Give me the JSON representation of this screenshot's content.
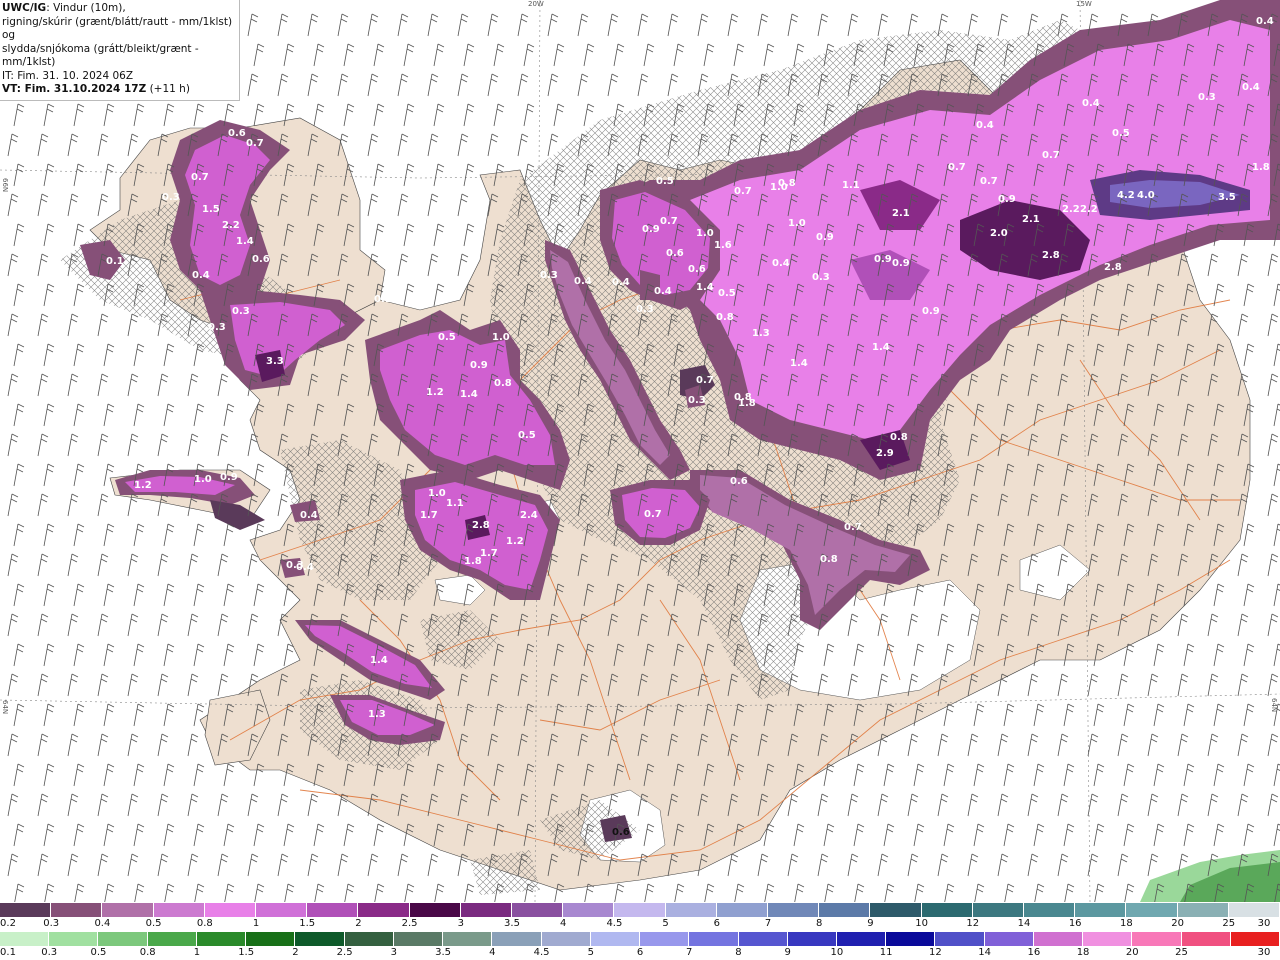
{
  "info": {
    "model": "UWC/IG",
    "line1_rest": ": Vindur (10m),",
    "line2": "rigning/skúrir (grænt/blátt/rautt - mm/1klst) og",
    "line3": "slydda/snjókoma (grátt/bleikt/grænt - mm/1klst)",
    "it": "IT: Fim. 31. 10. 2024 06Z",
    "vt_bold": "VT: Fim. 31.10.2024 17Z",
    "vt_rest": " (+11 h)"
  },
  "coord_labels": [
    "20W",
    "15W",
    "66N",
    "64N",
    "64N",
    "64N"
  ],
  "colors": {
    "land": "#eedfd0",
    "sea": "#ffffff",
    "roads": "#e0783c",
    "snow_light": "#b4709c",
    "snow_mid": "#d060d0",
    "snow_bright": "#ee80ee",
    "snow_dark": "#5a2860",
    "rain_green": "#78c080"
  },
  "precip_labels": [
    "0.6",
    "0.7",
    "0.3",
    "0.7",
    "2.2",
    "1.5",
    "1.4",
    "0.6",
    "0.4",
    "0.1",
    "0.3",
    "0.3",
    "3.3",
    "0.1",
    "0.5",
    "1.0",
    "1.2",
    "1.4",
    "0.9",
    "0.8",
    "0.5",
    "1.2",
    "1.0",
    "0.9",
    "0.4",
    "0.4",
    "1.0",
    "1.1",
    "1.7",
    "2.8",
    "2.4",
    "1.2",
    "1.7",
    "1.8",
    "1.4",
    "1.3",
    "0.5",
    "0.9",
    "0.7",
    "0.6",
    "1.0",
    "0.6",
    "1.4",
    "1.6",
    "0.3",
    "0.4",
    "0.4",
    "0.3",
    "0.4",
    "0.3",
    "0.7",
    "0.3",
    "0.8",
    "0.5",
    "0.8",
    "0.4",
    "0.3",
    "1.8",
    "1.3",
    "1.4",
    "0.7",
    "1.0",
    "0.8",
    "1.0",
    "0.4",
    "1.1",
    "0.9",
    "0.9",
    "0.9",
    "0.9",
    "2.1",
    "0.7",
    "0.7",
    "2.1",
    "2.2",
    "2.2",
    "2.0",
    "2.8",
    "2.8",
    "0.4",
    "0.5",
    "0.7",
    "0.3",
    "0.4",
    "0.4",
    "1.8",
    "4.2",
    "4.0",
    "3.5",
    "1.4",
    "0.9",
    "0.8",
    "2.9",
    "0.7",
    "0.7",
    "0.8",
    "0.6",
    "0.2",
    "0.3",
    "0.6"
  ],
  "legend": {
    "snow": {
      "colors": [
        "#5a3a5a",
        "#865078",
        "#b070a8",
        "#cc7ad0",
        "#e880e8",
        "#d070d8",
        "#b050b8",
        "#8a2a88",
        "#4a0848",
        "#7a2a80",
        "#8a50a0",
        "#a888d0",
        "#c4b8ee",
        "#aab0e0",
        "#90a0d0",
        "#7088b8",
        "#5c7aa8",
        "#2e5a6a",
        "#2c6a70",
        "#3c7880",
        "#4a8890",
        "#5c98a0",
        "#70a8b0",
        "#8ab0b4",
        "#d8e0e4"
      ],
      "labels": [
        "0.2",
        "0.3",
        "0.4",
        "0.5",
        "0.8",
        "1",
        "1.5",
        "2",
        "2.5",
        "3",
        "3.5",
        "4",
        "4.5",
        "5",
        "6",
        "7",
        "8",
        "9",
        "10",
        "12",
        "14",
        "16",
        "18",
        "20",
        "25",
        "30"
      ]
    },
    "rain": {
      "colors": [
        "#c8f0c8",
        "#a0e0a0",
        "#7cc87c",
        "#4aa84a",
        "#2a8a2a",
        "#187018",
        "#0e5a2a",
        "#346040",
        "#5a7a66",
        "#7a9a8a",
        "#8aa0b8",
        "#a0aad0",
        "#b0b8f0",
        "#9898ec",
        "#7474e0",
        "#5656d0",
        "#3838c0",
        "#2020b0",
        "#0a0a9a",
        "#5050c8",
        "#8060d8",
        "#d070d0",
        "#f090e0",
        "#f878b8",
        "#f05080",
        "#e82020"
      ],
      "labels": [
        "0.1",
        "0.3",
        "0.5",
        "0.8",
        "1",
        "1.5",
        "2",
        "2.5",
        "3",
        "3.5",
        "4",
        "4.5",
        "5",
        "6",
        "7",
        "8",
        "9",
        "10",
        "11",
        "12",
        "14",
        "16",
        "18",
        "20",
        "25",
        "30"
      ]
    }
  }
}
